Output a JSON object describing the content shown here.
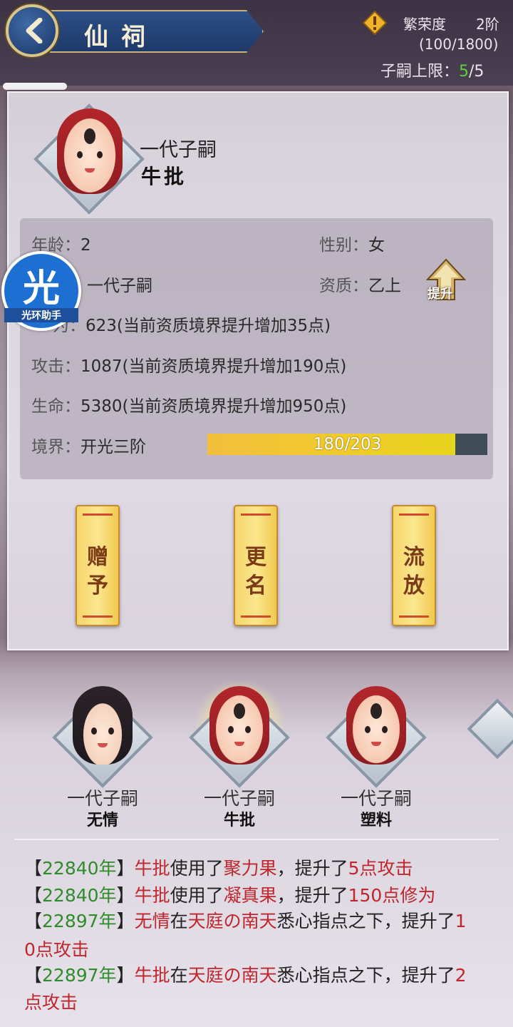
{
  "header": {
    "title": "仙祠",
    "prosperity_label": "繁荣度",
    "prosperity_level": "2阶",
    "prosperity_value": "(100/1800)",
    "heir_limit_label": "子嗣上限：",
    "heir_limit_current": "5",
    "heir_limit_total": "/5",
    "back_icon": "chevron-left-icon",
    "warning_icon": "warning-diamond-icon"
  },
  "selected": {
    "generation": "一代子嗣",
    "name": "牛批",
    "age_label": "年龄：",
    "age": "2",
    "gender_label": "性别：",
    "gender": "女",
    "type_value": "一代子嗣",
    "aptitude_label": "资质：",
    "aptitude": "乙上",
    "upgrade_label": "提升",
    "cultivation_label": "修为：",
    "cultivation_label_visible": "为：",
    "cultivation": "623(当前资质境界提升增加35点)",
    "attack_label": "攻击：",
    "attack": "1087(当前资质境界提升增加190点)",
    "hp_label": "生命：",
    "hp": "5380(当前资质境界提升增加950点)",
    "realm_label": "境界：",
    "realm": "开光三阶",
    "exp_text": "180/203",
    "exp_fraction": 0.8867
  },
  "actions": {
    "gift_top": "赠",
    "gift_bottom": "予",
    "rename_top": "更",
    "rename_bottom": "名",
    "exile_top": "流",
    "exile_bottom": "放"
  },
  "watermark": {
    "big": "光",
    "small": "光环助手"
  },
  "heirs": [
    {
      "generation": "一代子嗣",
      "name": "无情"
    },
    {
      "generation": "一代子嗣",
      "name": "牛批"
    },
    {
      "generation": "一代子嗣",
      "name": "塑料"
    }
  ],
  "log": [
    {
      "open": "【",
      "year": "22840年",
      "close": "】",
      "who": "牛批",
      "mid": "使用了",
      "item": "聚力果",
      "sep": "，提升了",
      "gain": "5点攻击"
    },
    {
      "open": "【",
      "year": "22840年",
      "close": "】",
      "who": "牛批",
      "mid": "使用了",
      "item": "凝真果",
      "sep": "，提升了",
      "gain": "150点修为"
    },
    {
      "open": "【",
      "year": "22897年",
      "close": "】",
      "who": "无情",
      "mid": "在",
      "item": "天庭の南天",
      "sep": "悉心指点之下，提升了",
      "gain_a": "1",
      "gain_b": "0点攻击"
    },
    {
      "open": "【",
      "year": "22897年",
      "close": "】",
      "who": "牛批",
      "mid": "在",
      "item": "天庭の南天",
      "sep": "悉心指点之下，提升了",
      "gain_a": "2",
      "gain_b": "点攻击"
    }
  ],
  "colors": {
    "green": "#2e8c2a",
    "red": "#c0262d",
    "gold": "#f0cc2a",
    "banner_blue": "#2c4f86"
  }
}
